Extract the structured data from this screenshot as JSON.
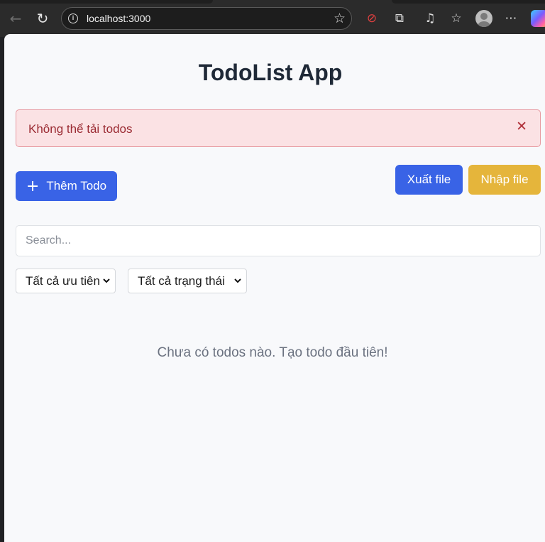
{
  "browser": {
    "url": "localhost:3000",
    "icons": [
      "back-icon",
      "reload-icon",
      "info-icon",
      "star-icon",
      "tracking-blocked-icon",
      "extensions-icon",
      "media-icon",
      "favorites-icon",
      "profile-avatar",
      "more-icon",
      "copilot-icon"
    ]
  },
  "app": {
    "title": "TodoList App",
    "alert": {
      "message": "Không thể tải todos",
      "close_symbol": "✕"
    },
    "toolbar": {
      "add_label": "Thêm Todo",
      "export_label": "Xuất file",
      "import_label": "Nhập file"
    },
    "search": {
      "placeholder": "Search...",
      "value": ""
    },
    "filters": {
      "priority_selected": "Tất cả ưu tiên",
      "status_selected": "Tất cả trạng thái"
    },
    "empty_message": "Chưa có todos nào. Tạo todo đầu tiên!"
  },
  "colors": {
    "primary": "#3963e6",
    "import": "#e5b53b",
    "alert_bg": "#fbe2e4",
    "alert_text": "#9b2b33"
  }
}
